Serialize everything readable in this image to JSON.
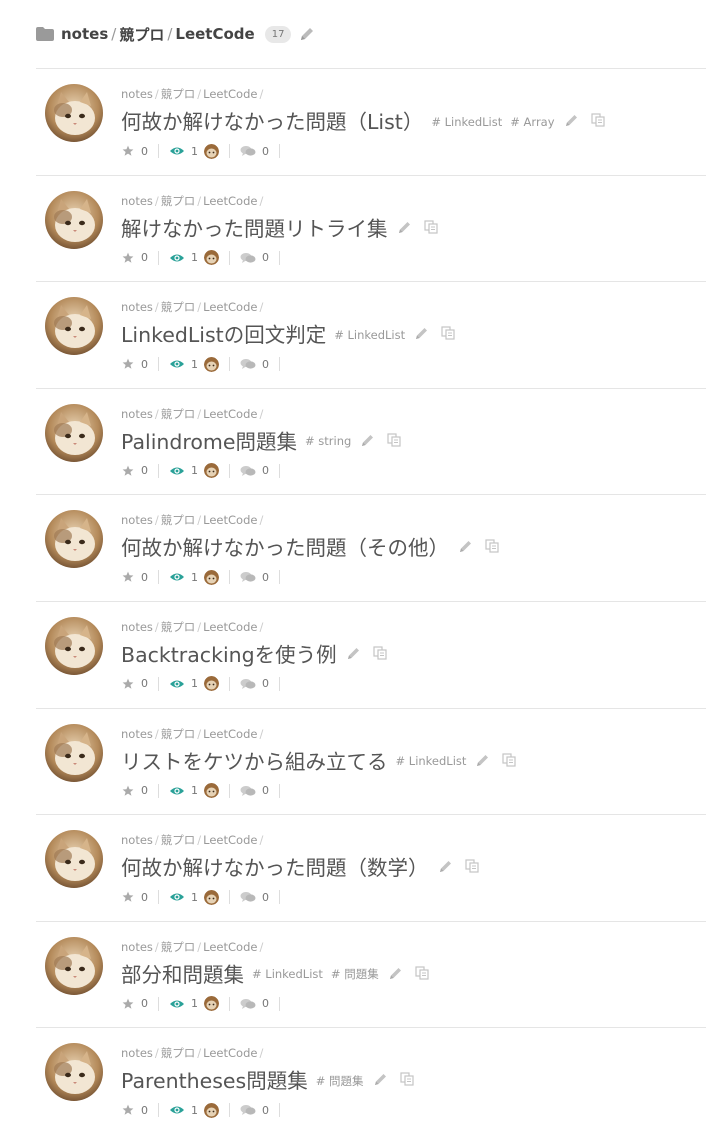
{
  "breadcrumb": {
    "items": [
      "notes",
      "競プロ",
      "LeetCode"
    ],
    "count": "17"
  },
  "path_parts": [
    "notes",
    "競プロ",
    "LeetCode"
  ],
  "notes": [
    {
      "title": "何故か解けなかった問題（List）",
      "tags": [
        "# LinkedList",
        "# Array"
      ],
      "stars": "0",
      "views": "1",
      "comments": "0"
    },
    {
      "title": "解けなかった問題リトライ集",
      "tags": [],
      "stars": "0",
      "views": "1",
      "comments": "0"
    },
    {
      "title": "LinkedListの回文判定",
      "tags": [
        "# LinkedList"
      ],
      "stars": "0",
      "views": "1",
      "comments": "0"
    },
    {
      "title": "Palindrome問題集",
      "tags": [
        "# string"
      ],
      "stars": "0",
      "views": "1",
      "comments": "0"
    },
    {
      "title": "何故か解けなかった問題（その他）",
      "tags": [],
      "stars": "0",
      "views": "1",
      "comments": "0"
    },
    {
      "title": "Backtrackingを使う例",
      "tags": [],
      "stars": "0",
      "views": "1",
      "comments": "0"
    },
    {
      "title": "リストをケツから組み立てる",
      "tags": [
        "# LinkedList"
      ],
      "stars": "0",
      "views": "1",
      "comments": "0"
    },
    {
      "title": "何故か解けなかった問題（数学）",
      "tags": [],
      "stars": "0",
      "views": "1",
      "comments": "0"
    },
    {
      "title": "部分和問題集",
      "tags": [
        "# LinkedList",
        "# 問題集"
      ],
      "stars": "0",
      "views": "1",
      "comments": "0"
    },
    {
      "title": "Parentheses問題集",
      "tags": [
        "# 問題集"
      ],
      "stars": "0",
      "views": "1",
      "comments": "0"
    }
  ],
  "icons": {
    "folder": "folder-icon",
    "edit": "pencil-icon",
    "copy": "copy-icon",
    "star": "star-icon",
    "views": "eye-icon",
    "comments": "comments-icon"
  },
  "colors": {
    "eye_accent": "#2aa198",
    "muted": "#999999",
    "title": "#555555",
    "divider": "#e5e5e5"
  }
}
